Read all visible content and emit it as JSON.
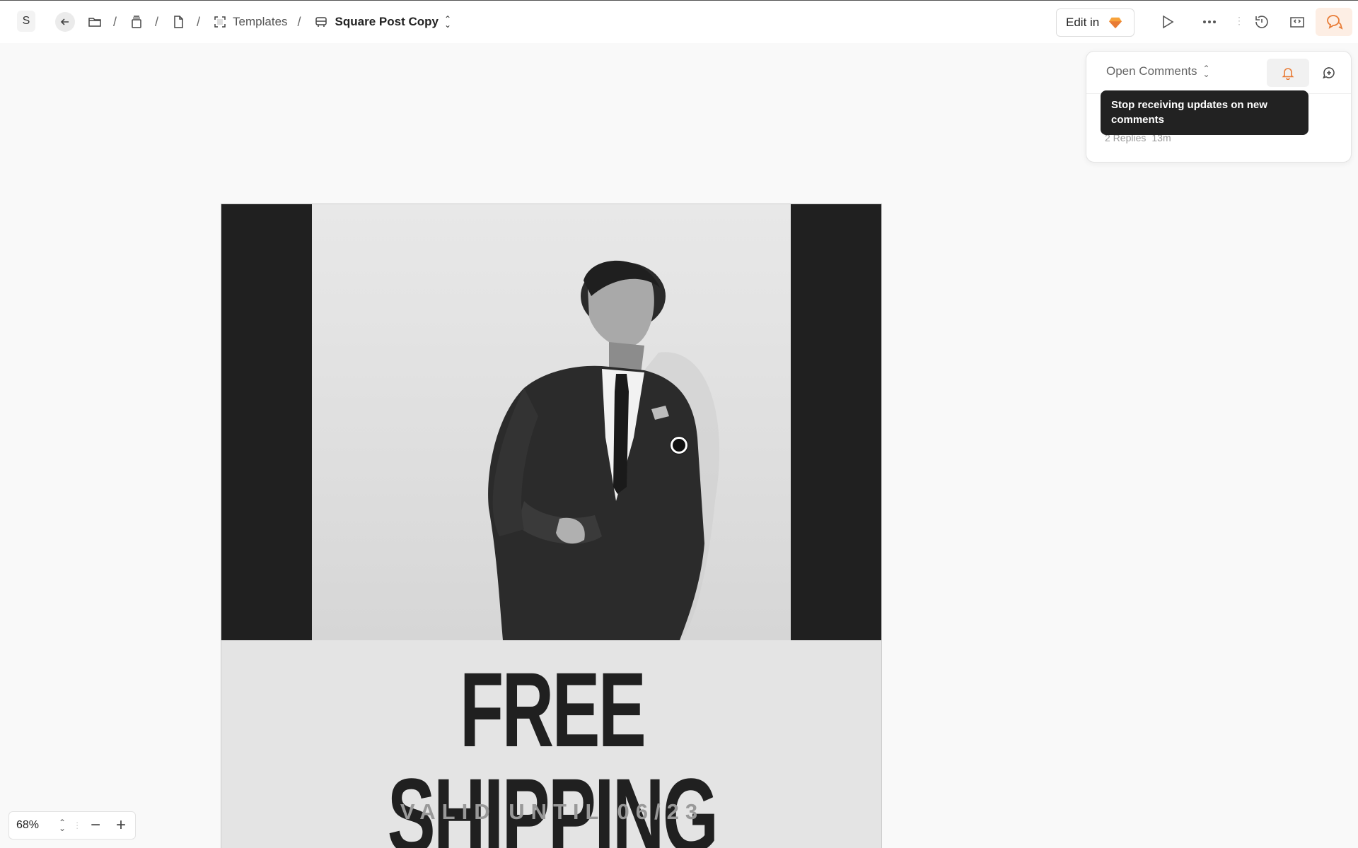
{
  "workspace": {
    "initial": "S"
  },
  "breadcrumb": {
    "templates_label": "Templates",
    "document_title": "Square Post Copy",
    "separator": "/"
  },
  "toolbar": {
    "edit_in_label": "Edit in",
    "icons": [
      "back-arrow-icon",
      "folder-icon",
      "library-icon",
      "page-icon",
      "artboard-icon",
      "symbol-icon",
      "sketch-gem-icon",
      "play-icon",
      "more-icon",
      "history-icon",
      "inspect-icon",
      "comments-icon"
    ],
    "accent_color": "#e87b35"
  },
  "comments_panel": {
    "filter_label": "Open Comments",
    "tooltip": "Stop receiving updates on new comments",
    "replies": "2 Replies",
    "time": "13m"
  },
  "canvas": {
    "headline": "FREE SHIPPING",
    "subline": "VALID UNTIL 06/23"
  },
  "zoom": {
    "value": "68%"
  }
}
